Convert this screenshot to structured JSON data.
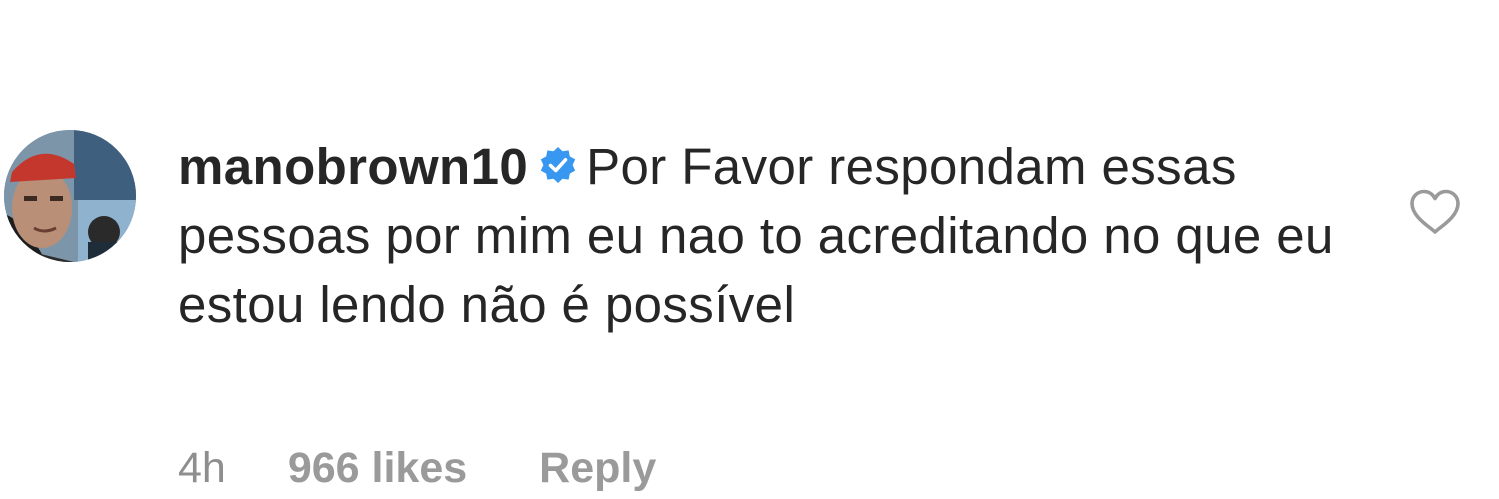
{
  "comment": {
    "username": "manobrown10",
    "verified": true,
    "verified_icon": "verified-badge-icon",
    "text": "Por Favor respondam essas pessoas por mim eu nao to acreditando no que eu estou lendo não é possível",
    "avatar_icon": "profile-avatar",
    "like_icon": "heart-outline-icon",
    "meta": {
      "time": "4h",
      "likes": "966 likes",
      "reply": "Reply"
    }
  },
  "colors": {
    "text": "#262626",
    "meta": "#8e8e8e",
    "verified": "#3897f0"
  }
}
